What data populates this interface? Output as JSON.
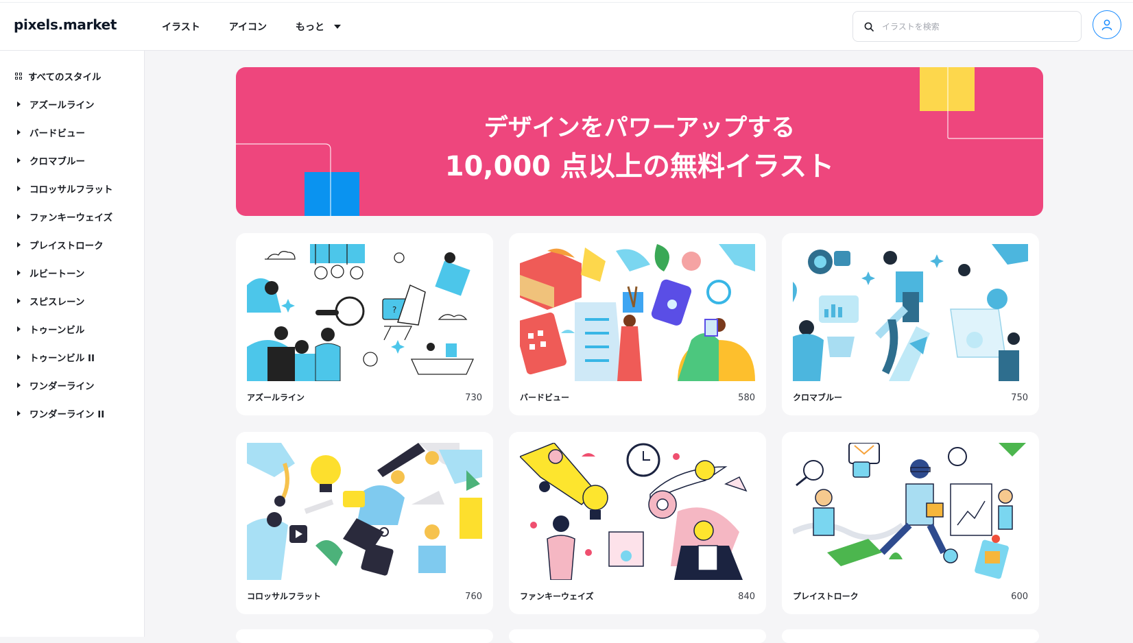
{
  "logo": "pixels.market",
  "nav": {
    "illustrations": "イラスト",
    "icons": "アイコン",
    "more": "もっと"
  },
  "search": {
    "placeholder": "イラストを検索"
  },
  "sidebar": {
    "all": "すべてのスタイル",
    "items": [
      "アズールライン",
      "バードビュー",
      "クロマブルー",
      "コロッサルフラット",
      "ファンキーウェイズ",
      "プレイストローク",
      "ルビートーン",
      "スピスレーン",
      "トゥーンビル",
      "トゥーンビル II",
      "ワンダーライン",
      "ワンダーライン II"
    ]
  },
  "banner": {
    "line1": "デザインをパワーアップする",
    "line2": "10,000 点以上の無料イラスト"
  },
  "cards": [
    {
      "name": "アズールライン",
      "count": "730"
    },
    {
      "name": "バードビュー",
      "count": "580"
    },
    {
      "name": "クロマブルー",
      "count": "750"
    },
    {
      "name": "コロッサルフラット",
      "count": "760"
    },
    {
      "name": "ファンキーウェイズ",
      "count": "840"
    },
    {
      "name": "プレイストローク",
      "count": "600"
    }
  ],
  "colors": {
    "banner_bg": "#ee467d",
    "accent_blue": "#1a8cff",
    "banner_yellow": "#fdd74c",
    "banner_blue": "#0a93f0"
  }
}
